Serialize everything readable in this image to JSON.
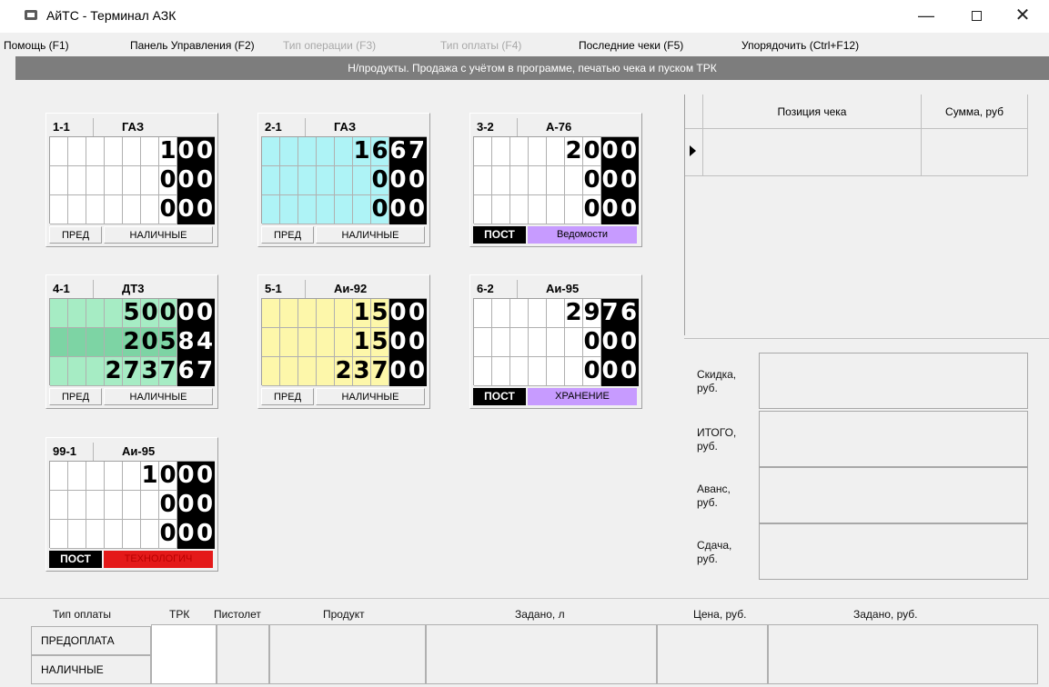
{
  "window": {
    "title": "АйТС - Терминал АЗК",
    "minimize": "—",
    "close": "✕"
  },
  "menu": [
    {
      "label": "Помощь (F1)",
      "enabled": true
    },
    {
      "label": "Панель Управления (F2)",
      "enabled": true
    },
    {
      "label": "Тип операции (F3)",
      "enabled": false
    },
    {
      "label": "Тип оплаты (F4)",
      "enabled": false
    },
    {
      "label": "Последние чеки (F5)",
      "enabled": true
    },
    {
      "label": "Упорядочить (Ctrl+F12)",
      "enabled": true
    }
  ],
  "info_bar": "Н/продукты. Продажа с учётом в программе, печатью чека и пуском ТРК",
  "pumps": [
    {
      "id": "1-1",
      "product": "ГАЗ",
      "rows": [
        "100",
        "000",
        "000"
      ],
      "left": "ПРЕД",
      "right": "НАЛИЧНЫЕ"
    },
    {
      "id": "2-1",
      "product": "ГАЗ",
      "rows": [
        "1667",
        "000",
        "000"
      ],
      "left": "ПРЕД",
      "right": "НАЛИЧНЫЕ"
    },
    {
      "id": "3-2",
      "product": "А-76",
      "rows": [
        "2000",
        "000",
        "000"
      ],
      "left": "ПОСТ",
      "right": "Ведомости"
    },
    {
      "id": "4-1",
      "product": "ДТ3",
      "rows": [
        "50000",
        "20584",
        "273767"
      ],
      "left": "ПРЕД",
      "right": "НАЛИЧНЫЕ"
    },
    {
      "id": "5-1",
      "product": "Аи-92",
      "rows": [
        "1500",
        "1500",
        "23700"
      ],
      "left": "ПРЕД",
      "right": "НАЛИЧНЫЕ"
    },
    {
      "id": "6-2",
      "product": "Аи-95",
      "rows": [
        "2976",
        "000",
        "000"
      ],
      "left": "ПОСТ",
      "right": "ХРАНЕНИЕ"
    },
    {
      "id": "99-1",
      "product": "Аи-95",
      "rows": [
        "1000",
        "000",
        "000"
      ],
      "left": "ПОСТ",
      "right": "ТЕХНОЛОГИЧ"
    }
  ],
  "receipt": {
    "col_position": "Позиция чека",
    "col_sum": "Сумма, руб"
  },
  "totals": {
    "discount": "Скидка, руб.",
    "total": "ИТОГО, руб.",
    "advance": "Аванс, руб.",
    "change": "Сдача, руб."
  },
  "bottom": {
    "headers": {
      "pay_type": "Тип оплаты",
      "trk": "ТРК",
      "nozzle": "Пистолет",
      "product": "Продукт",
      "set_liters": "Задано, л",
      "price": "Цена, руб.",
      "set_rub": "Задано, руб."
    },
    "pay_options": [
      "ПРЕДОПЛАТА",
      "НАЛИЧНЫЕ"
    ]
  },
  "colors": {
    "cyan": "#aef3f6",
    "green": "#a6ecc4",
    "green_dark": "#7dd4a4",
    "yellow": "#fdf7aa",
    "violet": "#c79bff",
    "red": "#e41919",
    "info_bar": "#7d7d7d"
  }
}
